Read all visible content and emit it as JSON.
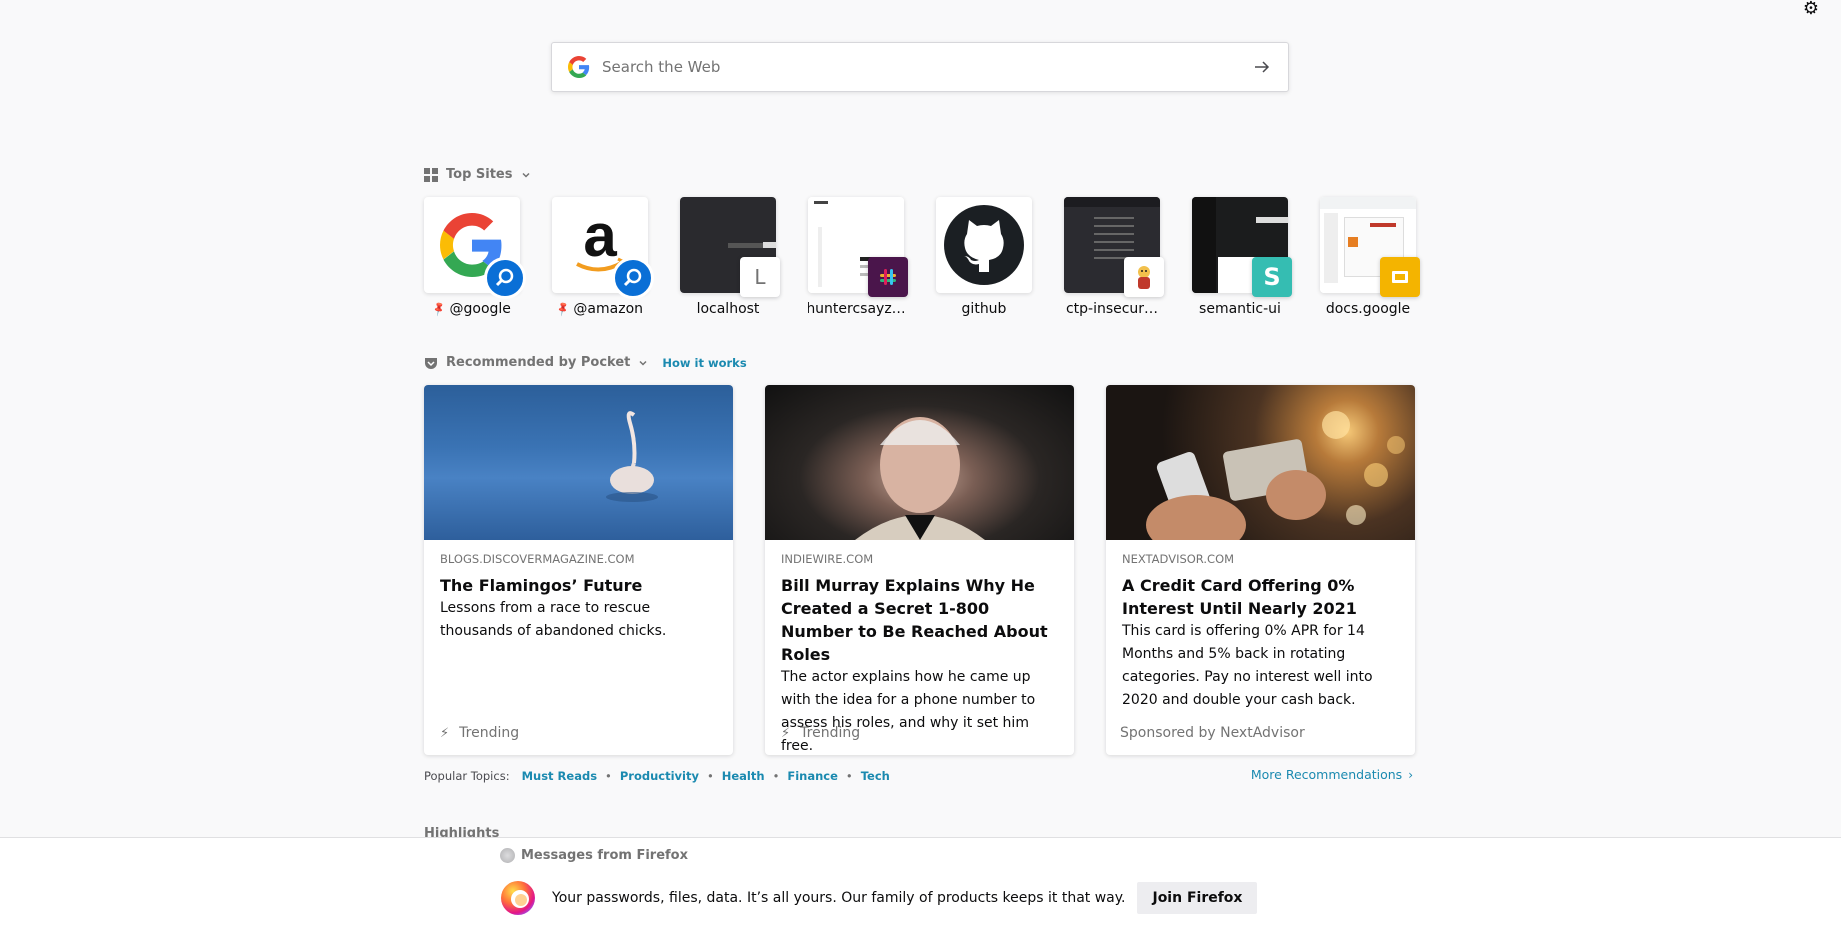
{
  "search": {
    "placeholder": "Search the Web"
  },
  "top_sites": {
    "title": "Top Sites",
    "sites": [
      {
        "label": "@google",
        "pinned": true,
        "icon": "google-logo"
      },
      {
        "label": "@amazon",
        "pinned": true,
        "icon": "amazon-logo"
      },
      {
        "label": "localhost",
        "icon": "screenshot"
      },
      {
        "label": "huntercsayz…",
        "icon": "screenshot"
      },
      {
        "label": "github",
        "icon": "github-logo"
      },
      {
        "label": "ctp-insecur…",
        "icon": "screenshot"
      },
      {
        "label": "semantic-ui",
        "icon": "screenshot"
      },
      {
        "label": "docs.google",
        "icon": "screenshot"
      }
    ]
  },
  "pocket": {
    "title": "Recommended by Pocket",
    "how_it_works": "How it works",
    "cards": [
      {
        "source": "BLOGS.DISCOVERMAGAZINE.COM",
        "title": "The Flamingos’ Future",
        "description": "Lessons from a race to rescue thousands of abandoned chicks.",
        "context": "Trending"
      },
      {
        "source": "INDIEWIRE.COM",
        "title": "Bill Murray Explains Why He Created a Secret 1-800 Number to Be Reached About Roles",
        "description": "The actor explains how he came up with the idea for a phone number to assess his roles, and why it set him free.",
        "context": "Trending"
      },
      {
        "source": "NEXTADVISOR.COM",
        "title": "A Credit Card Offering 0% Interest Until Nearly 2021",
        "description": "This card is offering 0% APR for 14 Months and 5% back in rotating categories. Pay no interest well into 2020 and double your cash back.",
        "context": "Sponsored by NextAdvisor"
      }
    ],
    "popular_topics_label": "Popular Topics:",
    "topics": [
      "Must Reads",
      "Productivity",
      "Health",
      "Finance",
      "Tech"
    ],
    "more_recommendations": "More Recommendations"
  },
  "highlights": {
    "title": "Highlights"
  },
  "messages": {
    "title": "Messages from Firefox",
    "text": "Your passwords, files, data. It’s all yours. Our family of products keeps it that way.",
    "button": "Join Firefox"
  },
  "colors": {
    "link": "#1b8ab0",
    "background": "#f9f9fa",
    "search_badge": "#0a6fd6"
  }
}
